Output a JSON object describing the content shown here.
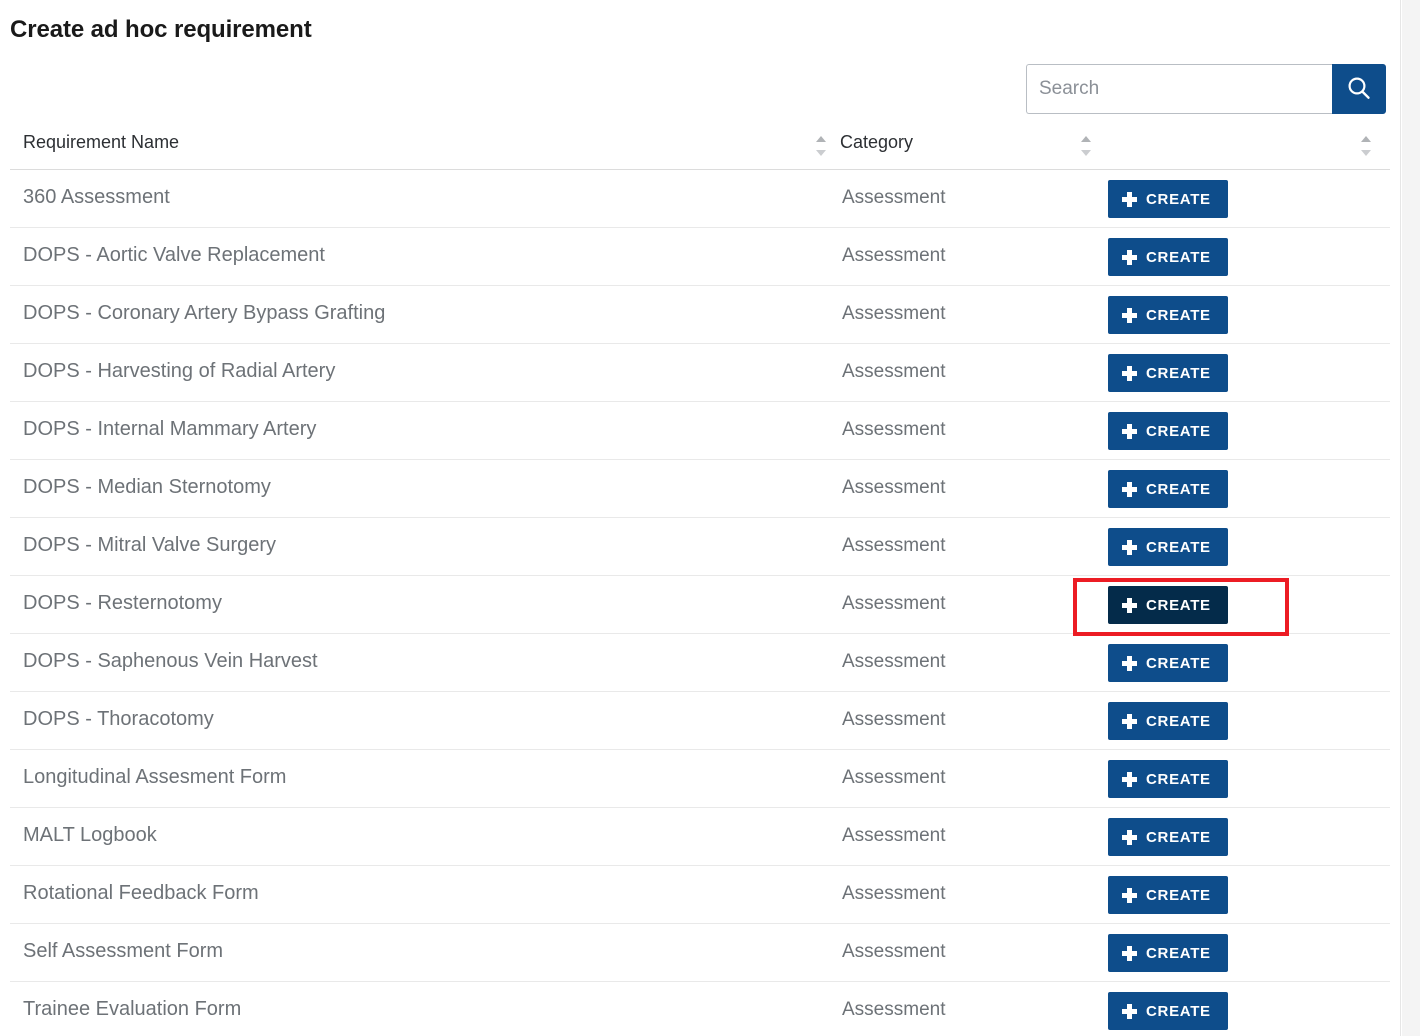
{
  "page": {
    "title": "Create ad hoc requirement"
  },
  "search": {
    "placeholder": "Search",
    "value": "",
    "button_icon": "search-icon"
  },
  "colors": {
    "primary_blue": "#0e4d8b",
    "hover_navy": "#042b4a",
    "annotation_red": "#ec1c24",
    "row_text": "#6d7277",
    "header_text": "#2c2f33",
    "row_divider": "#e9e9e9"
  },
  "table": {
    "columns": [
      {
        "label": "Requirement Name",
        "sortable": true
      },
      {
        "label": "Category",
        "sortable": true
      },
      {
        "label": "",
        "sortable": true
      }
    ],
    "action_label": "CREATE",
    "action_icon": "plus-icon",
    "highlighted_row_index": 7,
    "rows": [
      {
        "name": "360 Assessment",
        "category": "Assessment",
        "action": "CREATE"
      },
      {
        "name": "DOPS - Aortic Valve Replacement",
        "category": "Assessment",
        "action": "CREATE"
      },
      {
        "name": "DOPS - Coronary Artery Bypass Grafting",
        "category": "Assessment",
        "action": "CREATE"
      },
      {
        "name": "DOPS - Harvesting of Radial Artery",
        "category": "Assessment",
        "action": "CREATE"
      },
      {
        "name": "DOPS - Internal Mammary Artery",
        "category": "Assessment",
        "action": "CREATE"
      },
      {
        "name": "DOPS - Median Sternotomy",
        "category": "Assessment",
        "action": "CREATE"
      },
      {
        "name": "DOPS - Mitral Valve Surgery",
        "category": "Assessment",
        "action": "CREATE"
      },
      {
        "name": "DOPS - Resternotomy",
        "category": "Assessment",
        "action": "CREATE"
      },
      {
        "name": "DOPS - Saphenous Vein Harvest",
        "category": "Assessment",
        "action": "CREATE"
      },
      {
        "name": "DOPS - Thoracotomy",
        "category": "Assessment",
        "action": "CREATE"
      },
      {
        "name": "Longitudinal Assesment Form",
        "category": "Assessment",
        "action": "CREATE"
      },
      {
        "name": "MALT Logbook",
        "category": "Assessment",
        "action": "CREATE"
      },
      {
        "name": "Rotational Feedback Form",
        "category": "Assessment",
        "action": "CREATE"
      },
      {
        "name": "Self Assessment Form",
        "category": "Assessment",
        "action": "CREATE"
      },
      {
        "name": "Trainee Evaluation Form",
        "category": "Assessment",
        "action": "CREATE"
      }
    ]
  }
}
